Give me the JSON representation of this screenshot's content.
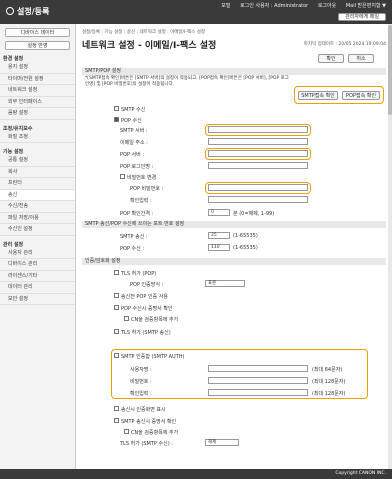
{
  "header": {
    "app_title": "설정/등록",
    "link_portal": "포털",
    "link_login_user": "로그인 사용자 : Administrator",
    "link_logout": "로그아웃",
    "link_mail": "Mail 받은편지함 ▼",
    "admin_button": "관리자에게 메일"
  },
  "sidebar": {
    "device_status_button": "디바이스 데이터",
    "apply_settings_button": "설정 반영",
    "groups": [
      {
        "label": "환경 설정",
        "items": [
          "용지 설정",
          "타이머/전원 설정",
          "네트워크 설정",
          "외부 인터페이스",
          "음량 설정"
        ]
      },
      {
        "label": "조정/유지보수",
        "items": [
          "화질 조정"
        ]
      },
      {
        "label": "기능 설정",
        "items": [
          "공통 설정",
          "복사",
          "프린터",
          "송신",
          "수신/전송",
          "파일 저장/이용",
          "수신인 설정"
        ]
      },
      {
        "label": "관리 설정",
        "items": [
          "사용자 관리",
          "디바이스 관리",
          "라이센스/기타",
          "데이터 관리",
          "보안 설정"
        ]
      }
    ]
  },
  "main": {
    "breadcrumb": "설정/등록 : 기능 설정 : 송신 : 네트워크 설정 : 이메일/I-팩스 설정",
    "page_title": "네트워크 설정 - 이메일/I-팩스 설정",
    "last_updated": "마지막 업데이트 : 20/05 2024 19:09:04",
    "ok_button": "확인",
    "cancel_button": "취소",
    "section_smtp_pop": "SMTP/POP 설정",
    "note": "*[SMTP접속 확인]버튼은 [SMTP 서버]의 설정이 적용되고, [POP접속 확인]버튼은 [POP 서버], [POP 로그인명] 및 [POP 비밀번호]의 설정이 적용됩니다.",
    "smtp_check_button": "SMTP접속 확인",
    "pop_check_button": "POP접속 확인",
    "smtp_rx_label": "SMTP 수신",
    "pop_rx_label": "POP 수신",
    "smtp_server_label": "SMTP 서버 :",
    "smtp_server_value": "",
    "email_label": "이메일 주소 :",
    "email_value": "",
    "pop_server_label": "POP 서버 :",
    "pop_server_value": "",
    "pop_login_label": "POP 로그인명 :",
    "pop_login_value": "",
    "set_password_label": "비밀번호 변경",
    "pop_password_label": "POP 비밀번호 :",
    "pop_password_value": "",
    "confirm_label": "확인입력 :",
    "confirm_value": "",
    "pop_interval_label": "POP 확인간격 :",
    "pop_interval_value": "0",
    "pop_interval_unit": "분 (0=해제, 1-99)",
    "section_ports": "SMTP 송신/POP 수신에 쓰이는 포트 번호 설정",
    "smtp_tx_port_label": "SMTP 송신 :",
    "smtp_tx_port_value": "25",
    "smtp_tx_port_range": "(1-65535)",
    "pop_rx_port_label": "POP 수신 :",
    "pop_rx_port_value": "110",
    "pop_rx_port_range": "(1-65535)",
    "section_auth": "인증/암호화 설정",
    "tls_pop_label": "TLS 허가 (POP)",
    "pop_auth_method_label": "POP 인증방식 :",
    "pop_auth_method_value": "표준",
    "pop_before_smtp_label": "송신전 POP 인증 사용",
    "pop_cert_label": "POP 수신시 증명서 확인",
    "pop_cn_label": "CN을 검증항목에 추가",
    "tls_smtp_label": "TLS 허가 (SMTP 송신)",
    "smtp_auth_label": "SMTP 인증함 (SMTP AUTH)",
    "username_label": "사용자명 :",
    "username_value": "",
    "username_hint": "(최대 64문자)",
    "password_label": "비밀번호 :",
    "password_value": "",
    "password_hint": "(최대 128문자)",
    "auth_confirm_label": "확인입력 :",
    "auth_confirm_value": "",
    "auth_confirm_hint": "(최대 128문자)",
    "auth_screen_label": "송신시 인증화면 표시",
    "smtp_cert_label": "SMTP 송신시 증명서 확인",
    "smtp_cn_label": "CN을 검증항목에 추가",
    "tls_smtp_rx_label": "TLS 허가 (SMTP 수신) :",
    "tls_smtp_rx_value": "해제"
  },
  "footer": {
    "copyright": "Copyright CANON INC."
  },
  "colors": {
    "highlight": "#f0a000",
    "header_bg": "#3a3a3a",
    "section_bg": "#e8e8e8"
  }
}
